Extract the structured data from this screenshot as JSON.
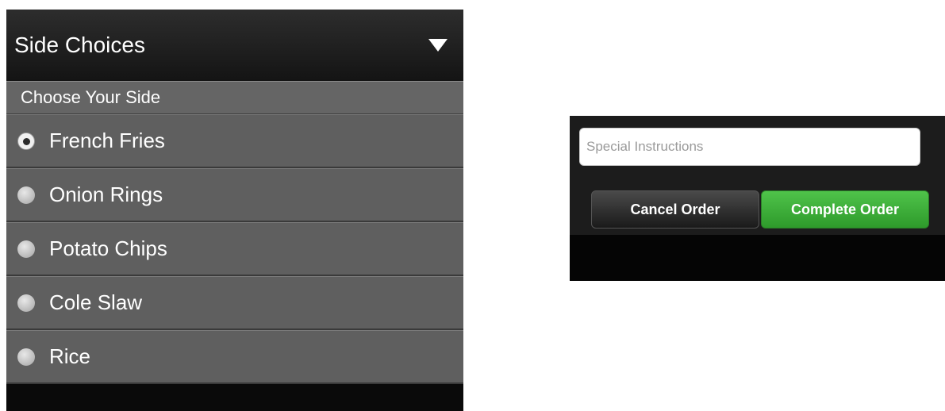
{
  "side_panel": {
    "title": "Side Choices",
    "dropdown_icon": "triangle-down-icon",
    "section_label": "Choose Your Side",
    "options": [
      {
        "label": "French Fries",
        "selected": true
      },
      {
        "label": "Onion Rings",
        "selected": false
      },
      {
        "label": "Potato Chips",
        "selected": false
      },
      {
        "label": "Cole Slaw",
        "selected": false
      },
      {
        "label": "Rice",
        "selected": false
      }
    ]
  },
  "order_panel": {
    "instructions_placeholder": "Special Instructions",
    "instructions_value": "",
    "cancel_label": "Cancel Order",
    "complete_label": "Complete Order",
    "complete_color": "#3dad38"
  }
}
